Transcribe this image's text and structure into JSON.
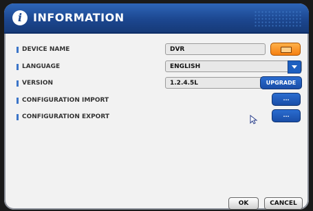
{
  "title": "INFORMATION",
  "rows": [
    {
      "label": "DEVICE NAME",
      "value": "DVR"
    },
    {
      "label": "LANGUAGE",
      "value": "ENGLISH"
    },
    {
      "label": "VERSION",
      "value": "1.2.4.5L",
      "button": "UPGRADE"
    },
    {
      "label": "CONFIGURATION IMPORT",
      "button": "..."
    },
    {
      "label": "CONFIGURATION EXPORT",
      "button": "..."
    }
  ],
  "footer": {
    "ok": "OK",
    "cancel": "CANCEL"
  },
  "icons": {
    "info": "info-icon",
    "keyboard": "keyboard-icon",
    "dropdown": "chevron-down-icon",
    "cursor": "mouse-cursor-icon"
  },
  "colors": {
    "title_bar": "#1c4790",
    "accent_button": "#1d5fc0",
    "keyboard_button": "#f57f10"
  }
}
